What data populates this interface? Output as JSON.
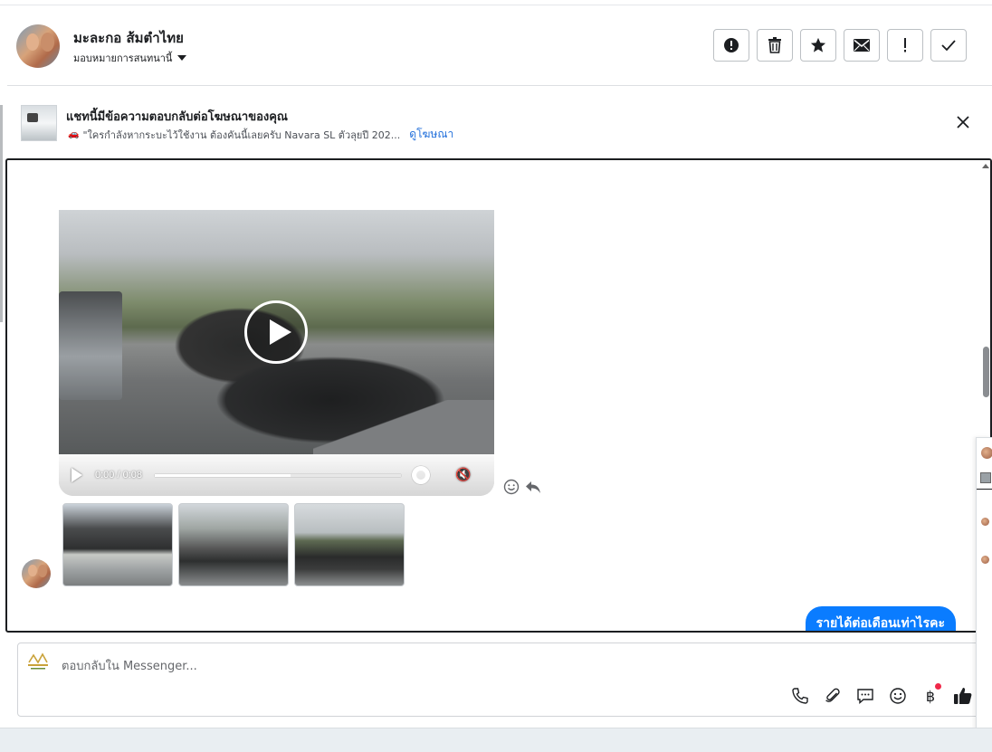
{
  "header": {
    "contact_name": "มะละกอ ส้มตำไทย",
    "assign_label": "มอบหมายการสนทนานี้",
    "actions": [
      {
        "name": "report",
        "label": "!"
      },
      {
        "name": "delete",
        "label": "🗑"
      },
      {
        "name": "star",
        "label": "★"
      },
      {
        "name": "mail",
        "label": "✉"
      },
      {
        "name": "important",
        "label": "!"
      },
      {
        "name": "done",
        "label": "✓"
      }
    ]
  },
  "ad_banner": {
    "title": "แชทนี้มีข้อความตอบกลับต่อโฆษณาของคุณ",
    "snippet_icon": "🚗",
    "snippet": "\"ใครกำลังหากระบะไว้ใช้งาน ต้องคันนี้เลยครับ Navara SL ตัวลุยปี 202...",
    "link": "ดูโฆษณา"
  },
  "video": {
    "time": "0:00 / 0:08",
    "progress": 0.55
  },
  "messages": {
    "outgoing": "รายได้ต่อเดือนเท่าไรคะ"
  },
  "composer": {
    "placeholder": "ตอบกลับใน Messenger..."
  },
  "colors": {
    "accent": "#0a7cff",
    "link": "#216fdb",
    "notification": "#f02849"
  }
}
